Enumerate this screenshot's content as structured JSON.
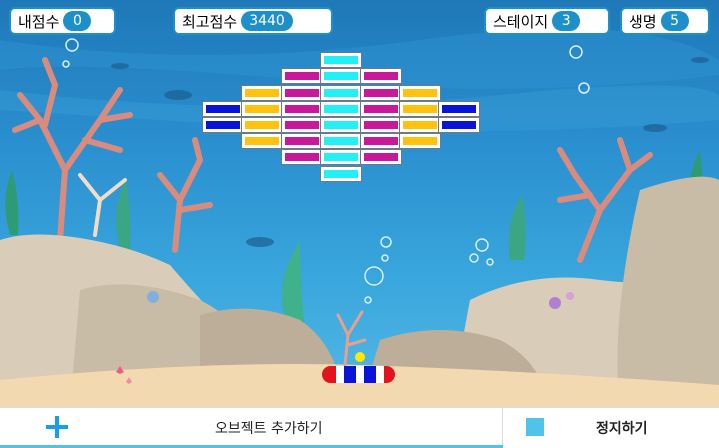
{
  "hud": {
    "my_score_label": "내점수",
    "my_score": "0",
    "high_score_label": "최고점수",
    "high_score": "3440",
    "stage_label": "스테이지",
    "stage": "3",
    "lives_label": "생명",
    "lives": "5"
  },
  "colors": {
    "cyan": "#22f0f4",
    "magenta": "#c8199a",
    "yellow": "#ffc20e",
    "blue": "#0a14d8",
    "hud_accent": "#1e90c9"
  },
  "bricks": {
    "rows": [
      [
        "",
        "",
        "",
        "cyan",
        "",
        "",
        ""
      ],
      [
        "",
        "",
        "magenta",
        "cyan",
        "magenta",
        "",
        ""
      ],
      [
        "",
        "yellow",
        "magenta",
        "cyan",
        "magenta",
        "yellow",
        ""
      ],
      [
        "blue",
        "yellow",
        "magenta",
        "cyan",
        "magenta",
        "yellow",
        "blue"
      ],
      [
        "blue",
        "yellow",
        "magenta",
        "cyan",
        "magenta",
        "yellow",
        "blue"
      ],
      [
        "",
        "yellow",
        "magenta",
        "cyan",
        "magenta",
        "yellow",
        ""
      ],
      [
        "",
        "",
        "magenta",
        "cyan",
        "magenta",
        "",
        ""
      ],
      [
        "",
        "",
        "",
        "cyan",
        "",
        "",
        ""
      ]
    ]
  },
  "bottom_bar": {
    "add_object": "오브젝트 추가하기",
    "stop": "정지하기"
  }
}
